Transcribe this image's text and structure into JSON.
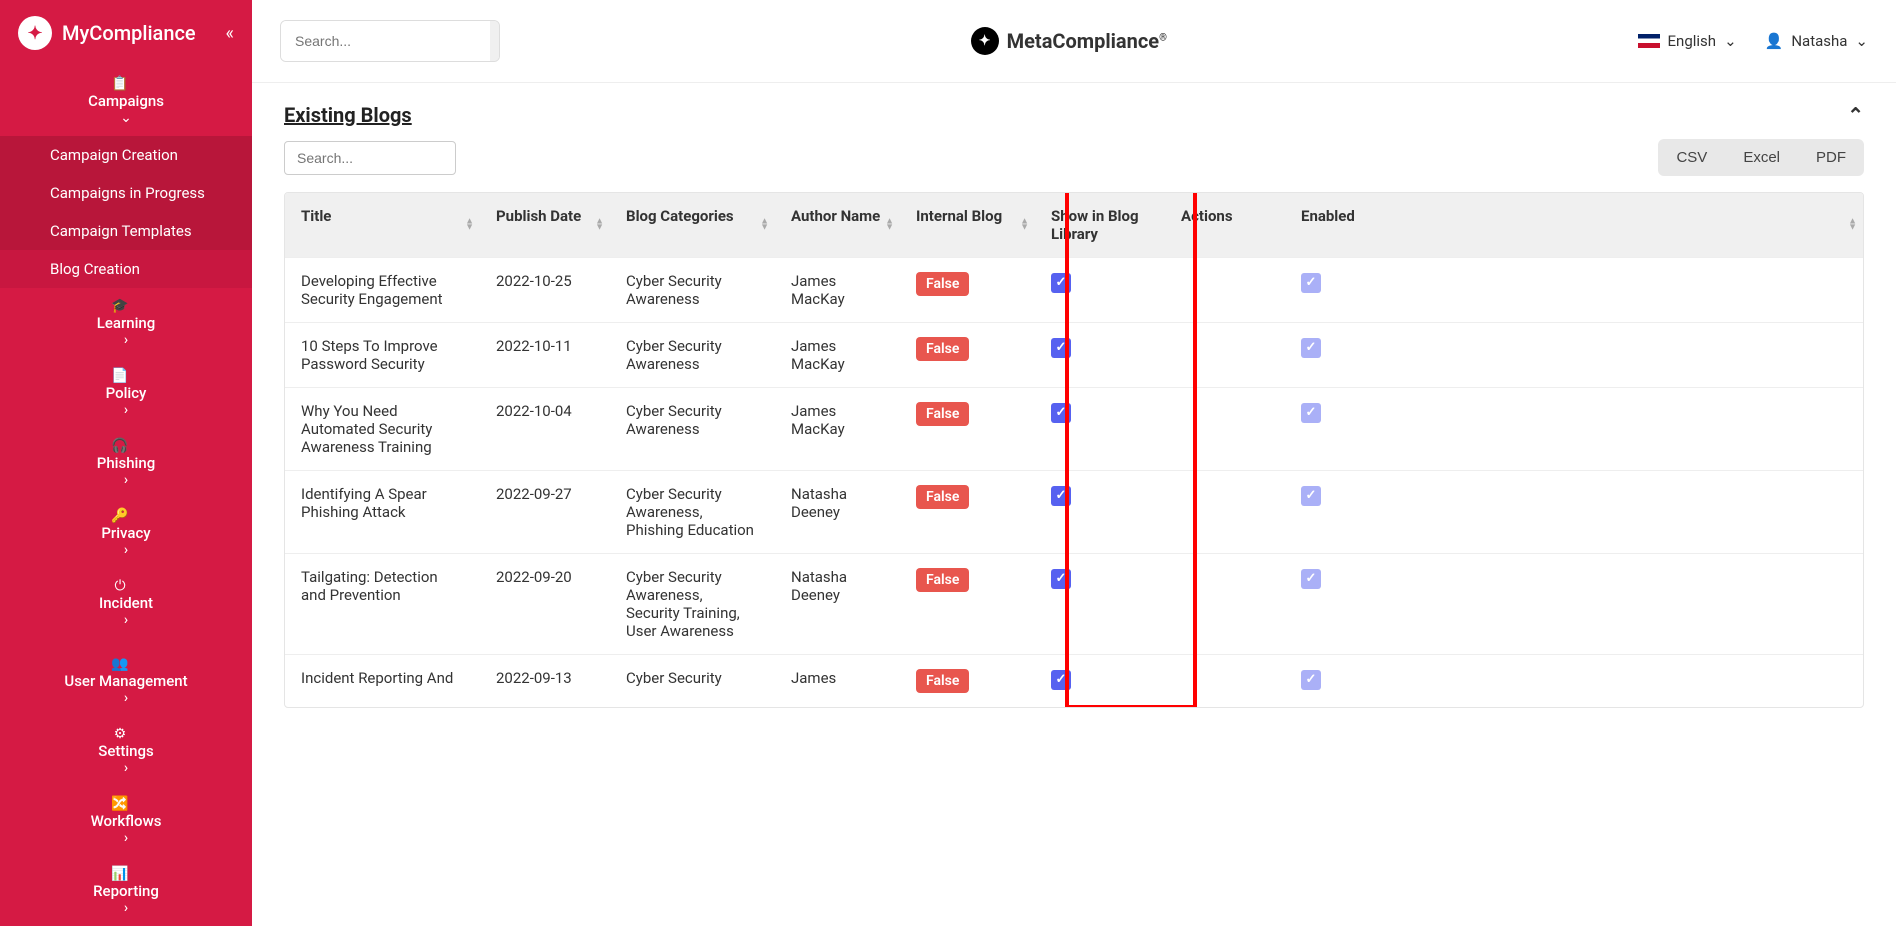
{
  "sidebar": {
    "title": "MyCompliance",
    "nav": [
      {
        "label": "Campaigns",
        "icon": "📋",
        "expanded": true,
        "subs": [
          {
            "label": "Campaign Creation"
          },
          {
            "label": "Campaigns in Progress"
          },
          {
            "label": "Campaign Templates"
          },
          {
            "label": "Blog Creation",
            "active": true
          }
        ]
      },
      {
        "label": "Learning",
        "icon": "🎓"
      },
      {
        "label": "Policy",
        "icon": "📄"
      },
      {
        "label": "Phishing",
        "icon": "🎧"
      },
      {
        "label": "Privacy",
        "icon": "🔑"
      },
      {
        "label": "Incident",
        "icon": "⏻"
      }
    ],
    "nav2": [
      {
        "label": "User Management",
        "icon": "👥"
      },
      {
        "label": "Settings",
        "icon": "⚙"
      },
      {
        "label": "Workflows",
        "icon": "🔀"
      },
      {
        "label": "Reporting",
        "icon": "📊"
      }
    ]
  },
  "header": {
    "search_placeholder": "Search...",
    "brand": "MetaCompliance",
    "brand_suffix": "®",
    "language": "English",
    "user": "Natasha"
  },
  "section": {
    "title": "Existing Blogs",
    "search_placeholder": "Search...",
    "export": {
      "csv": "CSV",
      "excel": "Excel",
      "pdf": "PDF"
    }
  },
  "table": {
    "headers": {
      "title": "Title",
      "publish_date": "Publish Date",
      "categories": "Blog Categories",
      "author": "Author Name",
      "internal": "Internal Blog",
      "show_library": "Show in Blog Library",
      "actions": "Actions",
      "enabled": "Enabled"
    },
    "rows": [
      {
        "title": "Developing Effective Security Engagement",
        "date": "2022-10-25",
        "categories": "Cyber Security Awareness",
        "author": "James MacKay",
        "internal": "False",
        "show": true,
        "enabled": true
      },
      {
        "title": "10 Steps To Improve Password Security",
        "date": "2022-10-11",
        "categories": "Cyber Security Awareness",
        "author": "James MacKay",
        "internal": "False",
        "show": true,
        "enabled": true
      },
      {
        "title": "Why You Need Automated Security Awareness Training",
        "date": "2022-10-04",
        "categories": "Cyber Security Awareness",
        "author": "James MacKay",
        "internal": "False",
        "show": true,
        "enabled": true
      },
      {
        "title": "Identifying A Spear Phishing Attack",
        "date": "2022-09-27",
        "categories": "Cyber Security Awareness, Phishing Education",
        "author": "Natasha Deeney",
        "internal": "False",
        "show": true,
        "enabled": true
      },
      {
        "title": "Tailgating: Detection and Prevention",
        "date": "2022-09-20",
        "categories": "Cyber Security Awareness, Security Training, User Awareness",
        "author": "Natasha Deeney",
        "internal": "False",
        "show": true,
        "enabled": true
      },
      {
        "title": "Incident Reporting And",
        "date": "2022-09-13",
        "categories": "Cyber Security",
        "author": "James",
        "internal": "False",
        "show": true,
        "enabled": true
      }
    ]
  }
}
